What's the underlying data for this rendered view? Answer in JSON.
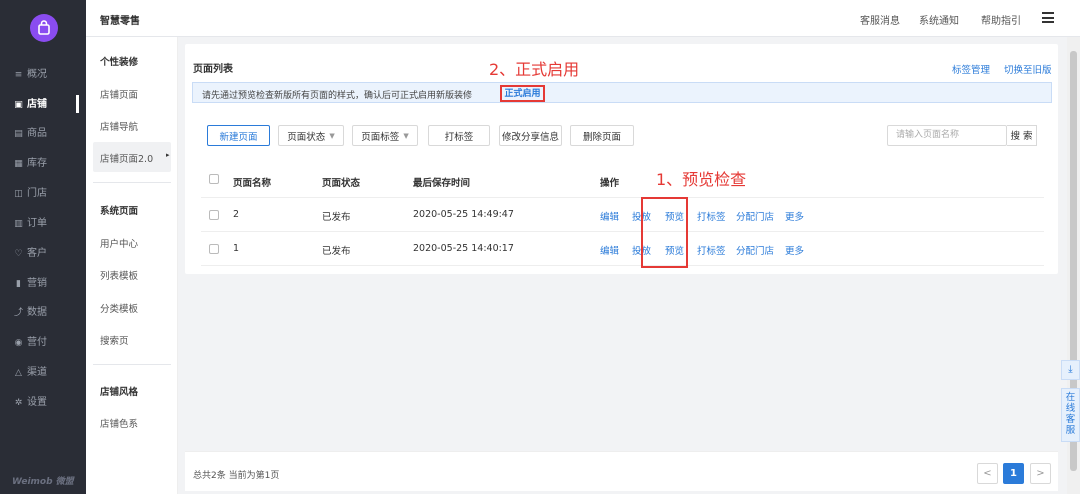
{
  "nav": {
    "items": [
      {
        "icon": "overview-icon",
        "glyph": "≡",
        "label": "概况"
      },
      {
        "icon": "store-icon",
        "glyph": "▣",
        "label": "店铺"
      },
      {
        "icon": "goods-icon",
        "glyph": "▤",
        "label": "商品"
      },
      {
        "icon": "inventory-icon",
        "glyph": "▦",
        "label": "库存"
      },
      {
        "icon": "shop-icon",
        "glyph": "◫",
        "label": "门店"
      },
      {
        "icon": "order-icon",
        "glyph": "▥",
        "label": "订单"
      },
      {
        "icon": "customer-icon",
        "glyph": "♡",
        "label": "客户"
      },
      {
        "icon": "marketing-icon",
        "glyph": "▮",
        "label": "营销"
      },
      {
        "icon": "data-icon",
        "glyph": "⤴",
        "label": "数据"
      },
      {
        "icon": "payment-icon",
        "glyph": "◉",
        "label": "营付"
      },
      {
        "icon": "channel-icon",
        "glyph": "△",
        "label": "渠道"
      },
      {
        "icon": "settings-icon",
        "glyph": "✲",
        "label": "设置"
      }
    ],
    "brand": "Weimob 微盟"
  },
  "topbar": {
    "app_name": "智慧零售",
    "links": [
      "客服消息",
      "系统通知",
      "帮助指引"
    ]
  },
  "subnav": {
    "items": [
      "个性装修",
      "店铺页面",
      "店铺导航",
      "店铺页面2.0",
      "系统页面",
      "用户中心",
      "列表模板",
      "分类模板",
      "搜索页",
      "店铺风格",
      "店铺色系"
    ]
  },
  "panel": {
    "title": "页面列表",
    "links": [
      "标签管理",
      "切换至旧版"
    ],
    "notice": "请先通过预览检查新版所有页面的样式，确认后可正式启用新版装修",
    "enable_label": "正式启用"
  },
  "toolbar": {
    "new_page": "新建页面",
    "page_status": "页面状态",
    "page_tag": "页面标签",
    "tag": "打标签",
    "share_info": "修改分享信息",
    "delete_page": "删除页面",
    "search_placeholder": "请输入页面名称",
    "search_btn": "搜 索"
  },
  "table": {
    "headers": [
      "页面名称",
      "页面状态",
      "最后保存时间",
      "操作"
    ],
    "rows": [
      {
        "name": "2",
        "status": "已发布",
        "time": "2020-05-25 14:49:47"
      },
      {
        "name": "1",
        "status": "已发布",
        "time": "2020-05-25 14:40:17"
      }
    ],
    "ops": [
      "编辑",
      "投放",
      "预览",
      "打标签",
      "分配门店",
      "更多"
    ]
  },
  "annotations": {
    "step2": "2、正式启用",
    "step1": "1、预览检查"
  },
  "footer": {
    "summary": "总共2条 当前为第1页",
    "prev": "<",
    "current_page": "1",
    "next": ">"
  },
  "float": {
    "download": "⤓",
    "customer_service": "在线客服"
  },
  "colors": {
    "nav_bg": "#2a2d36",
    "accent": "#2b7bd9",
    "annotation": "#e53935",
    "logo": "#8a4cf0"
  }
}
